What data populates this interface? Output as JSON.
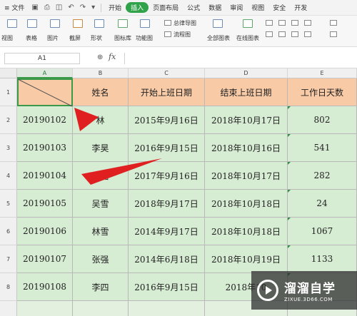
{
  "menubar": {
    "items": [
      {
        "label": "≡ 文件"
      },
      {
        "label": "开始"
      },
      {
        "label": "插入"
      },
      {
        "label": "页面布局"
      },
      {
        "label": "公式"
      },
      {
        "label": "数据"
      },
      {
        "label": "审阅"
      },
      {
        "label": "视图"
      },
      {
        "label": "安全"
      },
      {
        "label": "开发"
      }
    ],
    "active_index": 2
  },
  "ribbon": {
    "pivot_view": "视图",
    "table": "表格",
    "picture": "图片",
    "screenshot": "截屏",
    "shape": "形状",
    "icon_lib": "图标库",
    "func_chart": "功能图",
    "mindmap": "总律导图",
    "flowchart": "流程图",
    "all_charts": "全部图表",
    "online_charts": "在线图表"
  },
  "formula_bar": {
    "cell_ref": "A1",
    "fx": "fx"
  },
  "grid": {
    "columns": [
      "A",
      "B",
      "C",
      "D",
      "E"
    ],
    "rows": [
      "1",
      "2",
      "3",
      "4",
      "5",
      "6",
      "7",
      "8"
    ],
    "header": {
      "b": "姓名",
      "c": "开始上班日期",
      "d": "结束上班日期",
      "e": "工作日天数"
    },
    "data": [
      [
        "20190102",
        "林",
        "2015年9月16日",
        "2018年10月17日",
        "802"
      ],
      [
        "20190103",
        "李昊",
        "2016年9月15日",
        "2018年10月16日",
        "541"
      ],
      [
        "20190104",
        "王磊",
        "2017年9月16日",
        "2018年10月17日",
        "282"
      ],
      [
        "20190105",
        "吴雪",
        "2018年9月17日",
        "2018年10月18日",
        "24"
      ],
      [
        "20190106",
        "林雪",
        "2014年9月17日",
        "2018年10月18日",
        "1067"
      ],
      [
        "20190107",
        "张强",
        "2014年6月18日",
        "2018年10月19日",
        "1133"
      ],
      [
        "20190108",
        "李四",
        "2016年9月15日",
        "2018年10",
        ""
      ]
    ]
  },
  "watermark": {
    "name": "溜溜自学",
    "url": "ZIXUE.3D66.COM"
  },
  "colors": {
    "header_fill": "#f8caa6",
    "body_fill": "#d6ecd3",
    "accent": "#2fa24a",
    "arrow": "#e02020"
  }
}
